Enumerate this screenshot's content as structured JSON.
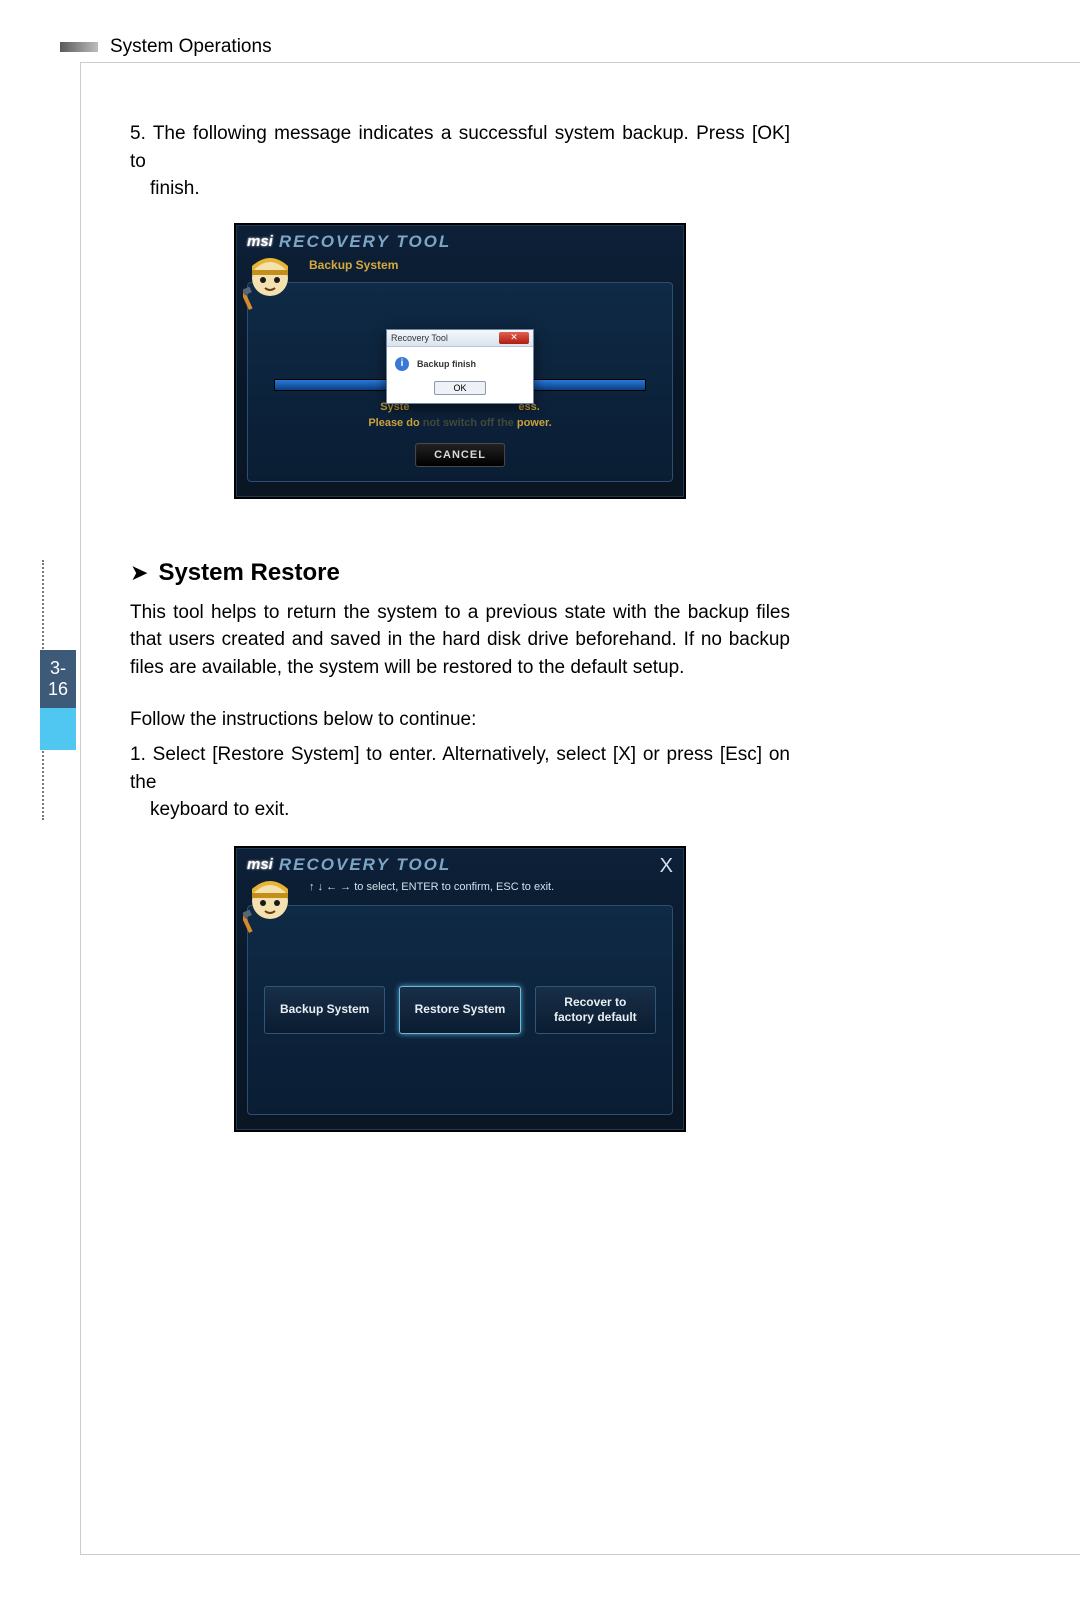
{
  "header": {
    "title": "System Operations"
  },
  "sidebar": {
    "page_ref": "3-16"
  },
  "step5_line1": "5. The following message indicates a successful system backup. Press [OK] to",
  "step5_line2": "finish.",
  "shot1": {
    "brand": "msi",
    "title": "RECOVERY TOOL",
    "subtitle": "Backup System",
    "progress_text1_left": "Syste",
    "progress_text1_right": "ess.",
    "progress_text2_left": "Please do",
    "progress_text2_mid": "not switch off the",
    "progress_text2_right": "power.",
    "cancel": "CANCEL",
    "dialog": {
      "title": "Recovery Tool",
      "message": "Backup finish",
      "ok": "OK"
    }
  },
  "section": {
    "title": "System Restore",
    "para": "This tool helps to return the system to a previous state with the backup files that users created and saved in the hard disk drive beforehand. If no backup files are available, the system will be restored to the default setup.",
    "follow": "Follow the instructions below to continue:",
    "step1_a": "1. Select [Restore System] to enter. Alternatively, select [X] or press [Esc] on the",
    "step1_b": "keyboard to exit."
  },
  "shot2": {
    "brand": "msi",
    "title": "RECOVERY TOOL",
    "hint": "↑ ↓ ← → to select, ENTER to confirm, ESC to exit.",
    "close": "X",
    "buttons": {
      "backup": "Backup System",
      "restore": "Restore System",
      "recover_l1": "Recover to",
      "recover_l2": "factory default"
    }
  }
}
